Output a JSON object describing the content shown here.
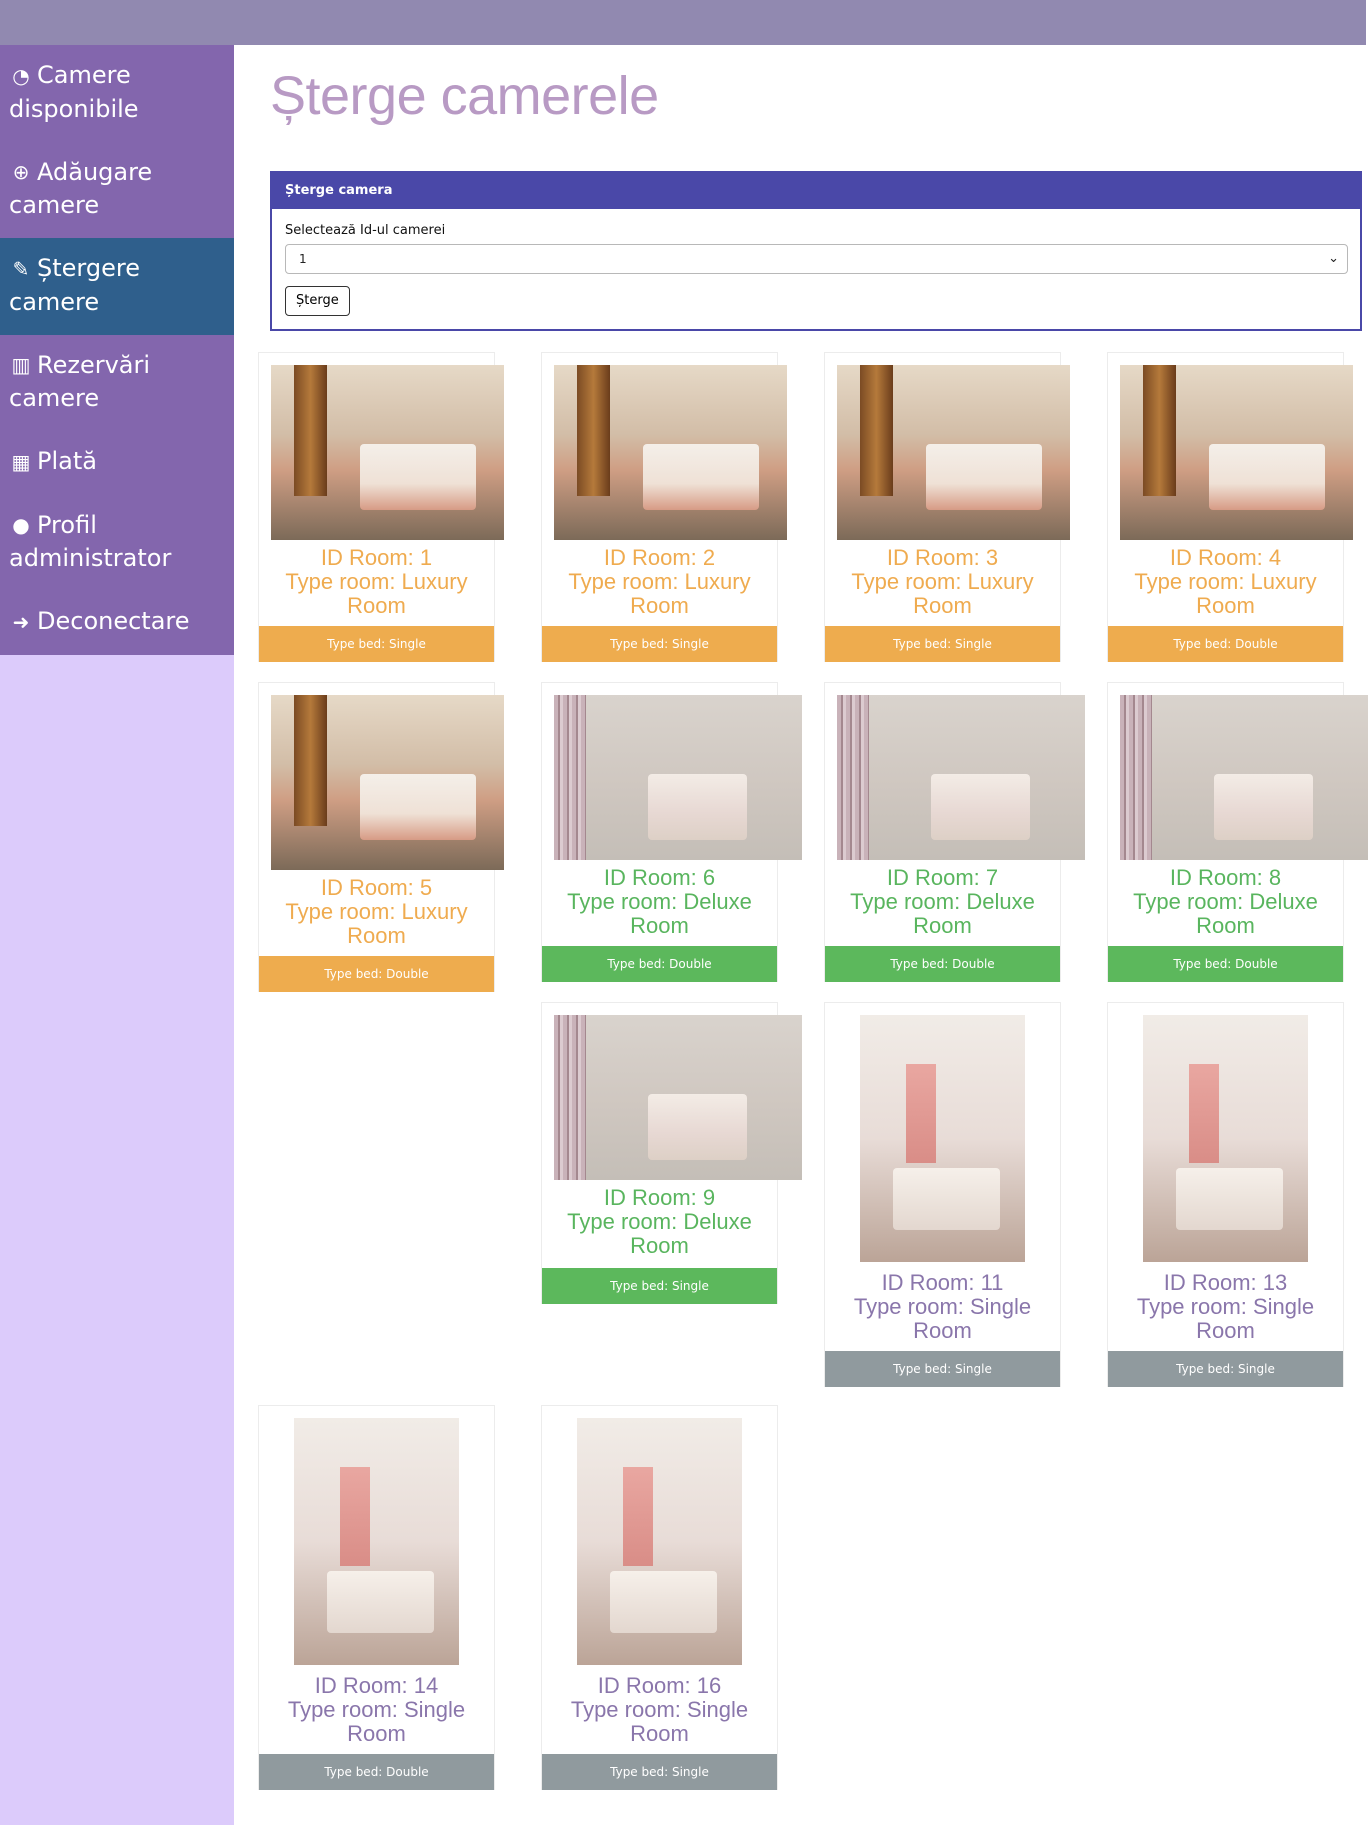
{
  "sidebar": {
    "items": [
      {
        "label": "Camere disponibile",
        "icon": "dashboard-icon",
        "glyph": "◔"
      },
      {
        "label": "Adăugare camere",
        "icon": "plus-circle-icon",
        "glyph": "⊕"
      },
      {
        "label": "Ștergere camere",
        "icon": "edit-icon",
        "glyph": "✎",
        "active": true
      },
      {
        "label": "Rezervări camere",
        "icon": "bar-chart-icon",
        "glyph": "▥"
      },
      {
        "label": "Plată",
        "icon": "qrcode-icon",
        "glyph": "▦"
      },
      {
        "label": "Profil administrator",
        "icon": "user-icon",
        "glyph": "●"
      },
      {
        "label": "Deconectare",
        "icon": "sign-out-icon",
        "glyph": "➜"
      }
    ]
  },
  "main": {
    "title": "Șterge camerele",
    "form": {
      "header": "Șterge camera",
      "label": "Selectează Id-ul camerei",
      "selected": "1",
      "button": "Șterge"
    }
  },
  "rooms": [
    {
      "id_text": "ID Room: 1",
      "type_text": "Type room: Luxury Room",
      "bed_text": "Type bed: Single",
      "style": "luxury"
    },
    {
      "id_text": "ID Room: 2",
      "type_text": "Type room: Luxury Room",
      "bed_text": "Type bed: Single",
      "style": "luxury"
    },
    {
      "id_text": "ID Room: 3",
      "type_text": "Type room: Luxury Room",
      "bed_text": "Type bed: Single",
      "style": "luxury"
    },
    {
      "id_text": "ID Room: 4",
      "type_text": "Type room: Luxury Room",
      "bed_text": "Type bed: Double",
      "style": "luxury"
    },
    {
      "id_text": "ID Room: 5",
      "type_text": "Type room: Luxury Room",
      "bed_text": "Type bed: Double",
      "style": "luxury"
    },
    {
      "id_text": "ID Room: 6",
      "type_text": "Type room: Deluxe Room",
      "bed_text": "Type bed: Double",
      "style": "deluxe"
    },
    {
      "id_text": "ID Room: 7",
      "type_text": "Type room: Deluxe Room",
      "bed_text": "Type bed: Double",
      "style": "deluxe"
    },
    {
      "id_text": "ID Room: 8",
      "type_text": "Type room: Deluxe Room",
      "bed_text": "Type bed: Double",
      "style": "deluxe"
    },
    {
      "id_text": "ID Room: 9",
      "type_text": "Type room: Deluxe Room",
      "bed_text": "Type bed: Single",
      "style": "deluxe"
    },
    {
      "id_text": "ID Room: 11",
      "type_text": "Type room: Single Room",
      "bed_text": "Type bed: Single",
      "style": "single"
    },
    {
      "id_text": "ID Room: 13",
      "type_text": "Type room: Single Room",
      "bed_text": "Type bed: Single",
      "style": "single"
    },
    {
      "id_text": "ID Room: 14",
      "type_text": "Type room: Single Room",
      "bed_text": "Type bed: Double",
      "style": "single"
    },
    {
      "id_text": "ID Room: 16",
      "type_text": "Type room: Single Room",
      "bed_text": "Type bed: Single",
      "style": "single"
    }
  ]
}
